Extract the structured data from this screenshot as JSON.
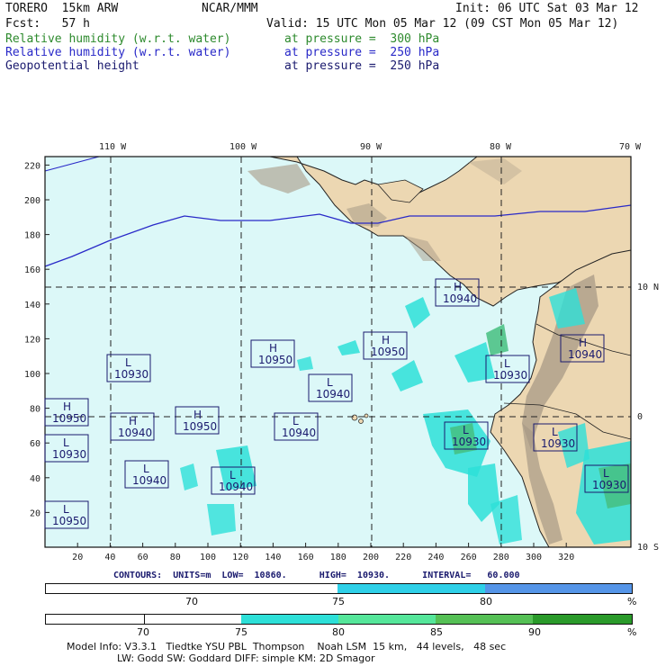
{
  "header": {
    "model": "TORERO  15km ARW",
    "center": "NCAR/MMM",
    "init": "Init: 06 UTC Sat 03 Mar 12",
    "fcst": "Fcst:   57 h",
    "valid": "Valid: 15 UTC Mon 05 Mar 12 (09 CST Mon 05 Mar 12)",
    "fields": [
      {
        "name": "Relative humidity (w.r.t. water)",
        "level": "at pressure =  300 hPa",
        "color": "#2d8a2d"
      },
      {
        "name": "Relative humidity (w.r.t. water)",
        "level": "at pressure =  250 hPa",
        "color": "#2929c8"
      },
      {
        "name": "Geopotential height",
        "level": "at pressure =  250 hPa",
        "color": "#1a1a6e"
      }
    ]
  },
  "map": {
    "lon_labels": [
      "110 W",
      "100 W",
      "90 W",
      "80 W",
      "70 W"
    ],
    "lat_labels": [
      "10 N",
      "0",
      "10 S"
    ],
    "x_ticks": [
      "20",
      "40",
      "60",
      "80",
      "100",
      "120",
      "140",
      "160",
      "180",
      "200",
      "220",
      "240",
      "260",
      "280",
      "300",
      "320"
    ],
    "y_ticks": [
      "20",
      "40",
      "60",
      "80",
      "100",
      "120",
      "140",
      "160",
      "180",
      "200",
      "220"
    ],
    "colors": {
      "ocean": "#dcf8f8",
      "land": "#ecd7b2",
      "terrain": "#a89a86",
      "coast": "#222222",
      "border": "#222222",
      "contour": "#2929c8",
      "grid": "#222222",
      "rh_cyan": "#2de0d8",
      "rh_green": "#45c080"
    },
    "highs_lows": [
      {
        "type": "H",
        "value": "10940"
      },
      {
        "type": "H",
        "value": "10950"
      },
      {
        "type": "L",
        "value": "10930"
      },
      {
        "type": "L",
        "value": "10940"
      },
      {
        "type": "H",
        "value": "10950"
      },
      {
        "type": "H",
        "value": "10950"
      },
      {
        "type": "H",
        "value": "10940"
      },
      {
        "type": "H",
        "value": "10950"
      },
      {
        "type": "L",
        "value": "10940"
      },
      {
        "type": "L",
        "value": "10930"
      },
      {
        "type": "L",
        "value": "10930"
      },
      {
        "type": "L",
        "value": "10930"
      },
      {
        "type": "L",
        "value": "10930"
      },
      {
        "type": "L",
        "value": "10930"
      },
      {
        "type": "L",
        "value": "10940"
      },
      {
        "type": "L",
        "value": "10940"
      },
      {
        "type": "H",
        "value": "10940"
      },
      {
        "type": "L",
        "value": "10950"
      }
    ]
  },
  "contours_line": "CONTOURS:  UNITS=m  LOW=  10860.      HIGH=  10930.      INTERVAL=   60.000",
  "scale_bars": [
    {
      "segments": [
        {
          "color": "#ffffff"
        },
        {
          "color": "#2fd0e8"
        },
        {
          "color": "#5595e8"
        }
      ],
      "labels": [
        "70",
        "75",
        "80",
        "%"
      ]
    },
    {
      "segments": [
        {
          "color": "#ffffff"
        },
        {
          "color": "#ffffff"
        },
        {
          "color": "#2de0d8"
        },
        {
          "color": "#55e69a"
        },
        {
          "color": "#55c055"
        },
        {
          "color": "#2a9a2a"
        }
      ],
      "labels": [
        "70",
        "75",
        "80",
        "85",
        "90",
        "%"
      ]
    }
  ],
  "footer": {
    "line1": "Model Info: V3.3.1   Tiedtke YSU PBL  Thompson    Noah LSM  15 km,   44 levels,   48 sec",
    "line2": "LW: Godd SW: Goddard DIFF: simple KM: 2D Smagor"
  }
}
